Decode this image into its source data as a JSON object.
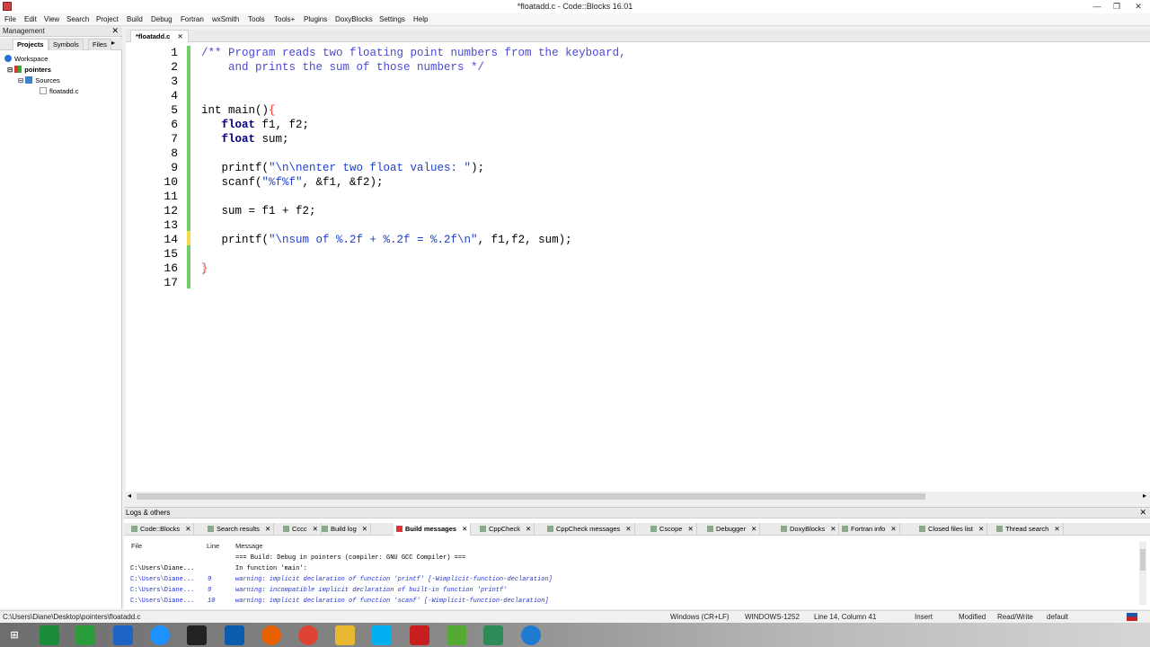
{
  "window": {
    "title": "*floatadd.c - Code::Blocks 16.01",
    "minimize": "—",
    "maximize": "❐",
    "close": "✕"
  },
  "menu": [
    "File",
    "Edit",
    "View",
    "Search",
    "Project",
    "Build",
    "Debug",
    "Fortran",
    "wxSmith",
    "Tools",
    "Tools+",
    "Plugins",
    "DoxyBlocks",
    "Settings",
    "Help"
  ],
  "management": {
    "title": "Management",
    "close": "✕",
    "tabs": [
      "Projects",
      "Symbols",
      "Files"
    ],
    "tabs_arrow": "▸",
    "tree": {
      "workspace": "Workspace",
      "project": "pointers",
      "folder": "Sources",
      "file": "floatadd.c",
      "expand_a": "⊟",
      "expand_b": "⊟"
    }
  },
  "editor": {
    "tab_label": "*floatadd.c",
    "tab_close": "✕",
    "lines": [
      {
        "n": "1",
        "parts": [
          {
            "t": "/** Program reads two floating point numbers from the keyboard,",
            "c": "cm"
          }
        ]
      },
      {
        "n": "2",
        "parts": [
          {
            "t": "    and prints the sum of those numbers */",
            "c": "cm"
          }
        ]
      },
      {
        "n": "3",
        "parts": []
      },
      {
        "n": "4",
        "parts": []
      },
      {
        "n": "5",
        "parts": [
          {
            "t": "int",
            "c": ""
          },
          {
            "t": " main",
            "c": ""
          },
          {
            "t": "()",
            "c": ""
          },
          {
            "t": "{",
            "c": "br"
          }
        ]
      },
      {
        "n": "6",
        "parts": [
          {
            "t": "   ",
            "c": ""
          },
          {
            "t": "float",
            "c": "kw"
          },
          {
            "t": " f1, f2;",
            "c": ""
          }
        ]
      },
      {
        "n": "7",
        "parts": [
          {
            "t": "   ",
            "c": ""
          },
          {
            "t": "float",
            "c": "kw"
          },
          {
            "t": " sum;",
            "c": ""
          }
        ]
      },
      {
        "n": "8",
        "parts": []
      },
      {
        "n": "9",
        "parts": [
          {
            "t": "   printf(",
            "c": ""
          },
          {
            "t": "\"\\n\\nenter two float values: \"",
            "c": "st"
          },
          {
            "t": ");",
            "c": ""
          }
        ]
      },
      {
        "n": "10",
        "parts": [
          {
            "t": "   scanf(",
            "c": ""
          },
          {
            "t": "\"%f%f\"",
            "c": "st"
          },
          {
            "t": ", &f1, &f2);",
            "c": ""
          }
        ]
      },
      {
        "n": "11",
        "parts": []
      },
      {
        "n": "12",
        "parts": [
          {
            "t": "   sum = f1 + f2;",
            "c": ""
          }
        ]
      },
      {
        "n": "13",
        "parts": []
      },
      {
        "n": "14",
        "parts": [
          {
            "t": "   printf(",
            "c": ""
          },
          {
            "t": "\"\\nsum of %.2f + %.2f = %.2f\\n\"",
            "c": "st"
          },
          {
            "t": ", f1,f2, sum);",
            "c": ""
          }
        ]
      },
      {
        "n": "15",
        "parts": []
      },
      {
        "n": "16",
        "parts": [
          {
            "t": "}",
            "c": "br"
          }
        ]
      },
      {
        "n": "17",
        "parts": []
      }
    ],
    "scroll_left": "◂",
    "scroll_right": "▸"
  },
  "logs": {
    "title": "Logs & others",
    "close": "✕",
    "tabs": [
      {
        "label": "Code::Blocks",
        "active": false
      },
      {
        "label": "Search results",
        "active": false
      },
      {
        "label": "Cccc",
        "active": false
      },
      {
        "label": "Build log",
        "active": false
      },
      {
        "label": "Build messages",
        "active": true
      },
      {
        "label": "CppCheck",
        "active": false
      },
      {
        "label": "CppCheck messages",
        "active": false
      },
      {
        "label": "Cscope",
        "active": false
      },
      {
        "label": "Debugger",
        "active": false
      },
      {
        "label": "DoxyBlocks",
        "active": false
      },
      {
        "label": "Fortran info",
        "active": false
      },
      {
        "label": "Closed files list",
        "active": false
      },
      {
        "label": "Thread search",
        "active": false
      }
    ],
    "tab_close": "✕",
    "columns": {
      "file": "File",
      "line": "Line",
      "message": "Message"
    },
    "rows": [
      {
        "file": "",
        "line": "",
        "message": "=== Build: Debug in pointers (compiler: GNU GCC Compiler) ===",
        "warn": false
      },
      {
        "file": "C:\\Users\\Diane...",
        "line": "",
        "message": "In function 'main':",
        "warn": false
      },
      {
        "file": "C:\\Users\\Diane...",
        "line": "9",
        "message": "warning: implicit declaration of function 'printf' [-Wimplicit-function-declaration]",
        "warn": true
      },
      {
        "file": "C:\\Users\\Diane...",
        "line": "9",
        "message": "warning: incompatible implicit declaration of built-in function 'printf'",
        "warn": true
      },
      {
        "file": "C:\\Users\\Diane...",
        "line": "10",
        "message": "warning: implicit declaration of function 'scanf' [-Wimplicit-function-declaration]",
        "warn": true
      }
    ]
  },
  "status": {
    "path": "C:\\Users\\Diane\\Desktop\\pointers\\floatadd.c",
    "eol": "Windows (CR+LF)",
    "encoding": "WINDOWS-1252",
    "position": "Line 14, Column 41",
    "mode": "Insert",
    "modified": "Modified",
    "access": "Read/Write",
    "lang": "default"
  },
  "taskbar": {
    "colors": {
      "start": "#ffffff",
      "ie": "#1e90ff",
      "chrome": "#dd4433",
      "firefox": "#e66000",
      "explorer": "#e8b830",
      "outlook": "#0b5cad",
      "skype": "#00aff0",
      "word": "#2b579a",
      "pdf": "#c81e1e",
      "cb": "#55aa33",
      "green": "#1a8c3a",
      "dark": "#222222",
      "blue2": "#1f63c6"
    }
  }
}
